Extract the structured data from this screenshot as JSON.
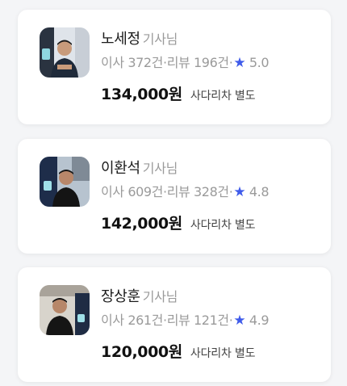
{
  "drivers": [
    {
      "name": "노세정",
      "suffix": "기사님",
      "moves_label": "이사",
      "moves_count": "372건",
      "sep": "·",
      "reviews_label": "리뷰",
      "reviews_count": "196건",
      "rating_icon": "star-icon",
      "rating": "5.0",
      "price": "134,000원",
      "note": "사다리차 별도"
    },
    {
      "name": "이환석",
      "suffix": "기사님",
      "moves_label": "이사",
      "moves_count": "609건",
      "sep": "·",
      "reviews_label": "리뷰",
      "reviews_count": "328건",
      "rating_icon": "star-icon",
      "rating": "4.8",
      "price": "142,000원",
      "note": "사다리차 별도"
    },
    {
      "name": "장상훈",
      "suffix": "기사님",
      "moves_label": "이사",
      "moves_count": "261건",
      "sep": "·",
      "reviews_label": "리뷰",
      "reviews_count": "121건",
      "rating_icon": "star-icon",
      "rating": "4.9",
      "price": "120,000원",
      "note": "사다리차 별도"
    }
  ],
  "colors": {
    "star": "#3f5bea",
    "muted": "#9a9a9a",
    "text": "#1b1b1b"
  }
}
